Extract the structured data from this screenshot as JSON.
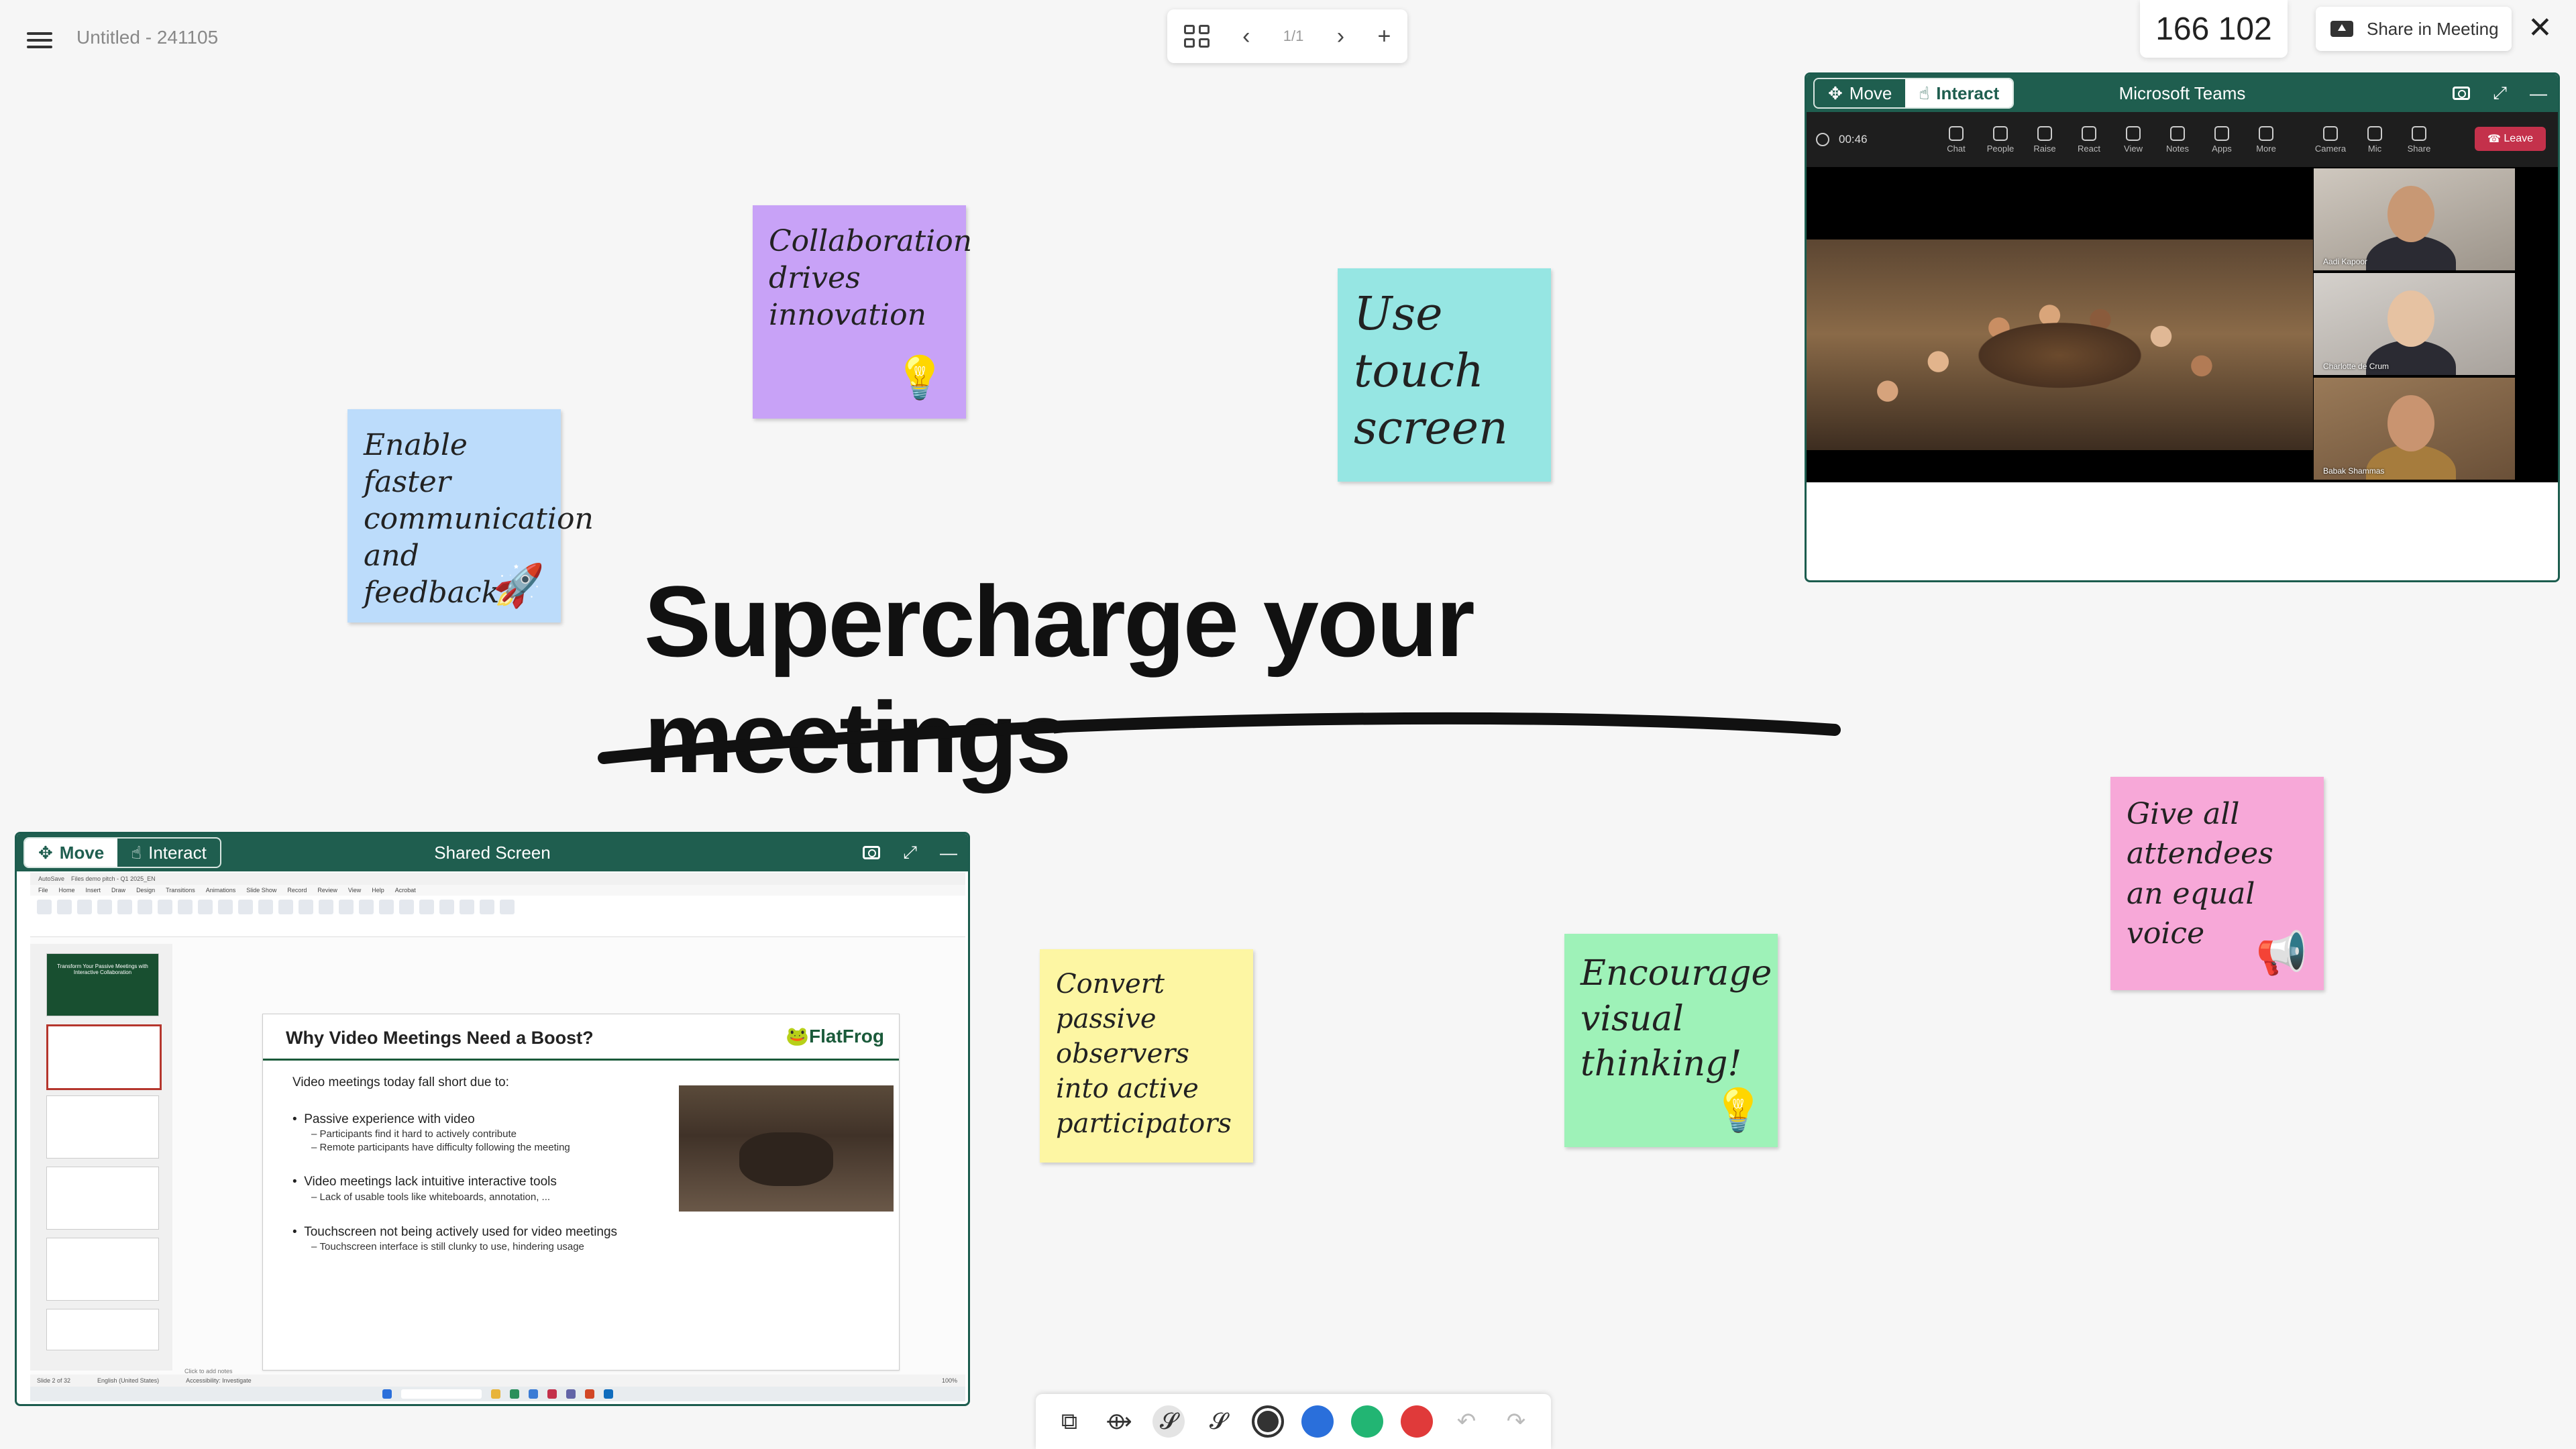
{
  "document": {
    "title": "Untitled - 241105"
  },
  "pager": {
    "page": "1/1"
  },
  "counter": {
    "value": "166 102"
  },
  "share": {
    "label": "Share in Meeting"
  },
  "headline": "Supercharge your meetings",
  "notes": [
    {
      "id": "enable",
      "text": "Enable faster communication and feedback",
      "color": "#bcdcfb",
      "icon": "rocket-icon"
    },
    {
      "id": "collab",
      "text": "Collaboration drives innovation",
      "color": "#c8a2f7",
      "icon": "lightbulb-icon"
    },
    {
      "id": "touch",
      "text": "Use touch screen",
      "color": "#96e6e3"
    },
    {
      "id": "convert",
      "text": "Convert passive observers into active participators",
      "color": "#fdf6a3"
    },
    {
      "id": "visual",
      "text": "Encourage visual thinking!",
      "color": "#9ef2b8",
      "icon": "lightbulb-icon"
    },
    {
      "id": "voice",
      "text": "Give all attendees an equal voice",
      "color": "#f7a8d8",
      "icon": "megaphone-icon"
    }
  ],
  "teams_window": {
    "move_label": "Move",
    "interact_label": "Interact",
    "title": "Microsoft Teams",
    "timer": "00:46",
    "tools": [
      "Chat",
      "People",
      "Raise",
      "React",
      "View",
      "Notes",
      "Apps",
      "More",
      "Camera",
      "Mic",
      "Share"
    ],
    "leave_label": "Leave",
    "participants": [
      "Aadi Kapoor",
      "Charlotte de Crum",
      "Babak Shammas"
    ]
  },
  "shared_window": {
    "move_label": "Move",
    "interact_label": "Interact",
    "title": "Shared Screen",
    "ppt": {
      "titlebar": "AutoSave",
      "file": "Files demo pitch - Q1 2025_EN",
      "tabs": [
        "File",
        "Home",
        "Insert",
        "Draw",
        "Design",
        "Transitions",
        "Animations",
        "Slide Show",
        "Record",
        "Review",
        "View",
        "Help",
        "Acrobat"
      ],
      "slide_title": "Why Video Meetings Need a Boost?",
      "logo": "FlatFrog",
      "intro": "Video meetings today fall short due to:",
      "bullets": [
        {
          "text": "Passive experience with video",
          "subs": [
            "Participants find it hard to actively contribute",
            "Remote participants have difficulty following the meeting"
          ]
        },
        {
          "text": "Video meetings lack intuitive interactive tools",
          "subs": [
            "Lack of usable tools like whiteboards, annotation, ..."
          ]
        },
        {
          "text": "Touchscreen not being actively used for video meetings",
          "subs": [
            "Touchscreen interface is still clunky to use, hindering usage"
          ]
        }
      ],
      "thumb1_text": "Transform Your Passive Meetings with Interactive Collaboration",
      "notes_hint": "Click to add notes",
      "status_left": "Slide 2 of 32",
      "status_lang": "English (United States)",
      "status_access": "Accessibility: Investigate",
      "zoom": "100%"
    }
  },
  "toolbar": {
    "colors": [
      "#333333",
      "#2a6fdb",
      "#22b573",
      "#e03a3a"
    ]
  }
}
